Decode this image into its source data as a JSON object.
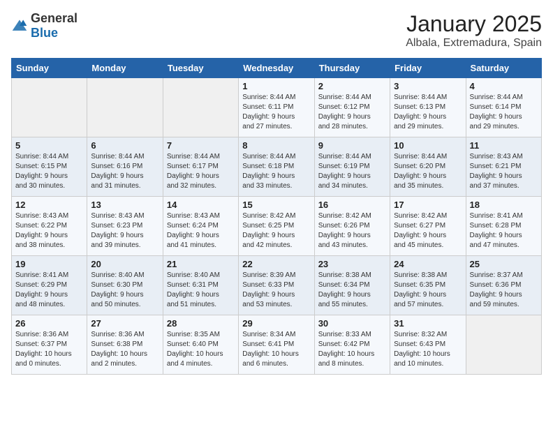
{
  "header": {
    "logo_general": "General",
    "logo_blue": "Blue",
    "month_year": "January 2025",
    "location": "Albala, Extremadura, Spain"
  },
  "weekdays": [
    "Sunday",
    "Monday",
    "Tuesday",
    "Wednesday",
    "Thursday",
    "Friday",
    "Saturday"
  ],
  "weeks": [
    [
      {
        "day": "",
        "detail": ""
      },
      {
        "day": "",
        "detail": ""
      },
      {
        "day": "",
        "detail": ""
      },
      {
        "day": "1",
        "detail": "Sunrise: 8:44 AM\nSunset: 6:11 PM\nDaylight: 9 hours\nand 27 minutes."
      },
      {
        "day": "2",
        "detail": "Sunrise: 8:44 AM\nSunset: 6:12 PM\nDaylight: 9 hours\nand 28 minutes."
      },
      {
        "day": "3",
        "detail": "Sunrise: 8:44 AM\nSunset: 6:13 PM\nDaylight: 9 hours\nand 29 minutes."
      },
      {
        "day": "4",
        "detail": "Sunrise: 8:44 AM\nSunset: 6:14 PM\nDaylight: 9 hours\nand 29 minutes."
      }
    ],
    [
      {
        "day": "5",
        "detail": "Sunrise: 8:44 AM\nSunset: 6:15 PM\nDaylight: 9 hours\nand 30 minutes."
      },
      {
        "day": "6",
        "detail": "Sunrise: 8:44 AM\nSunset: 6:16 PM\nDaylight: 9 hours\nand 31 minutes."
      },
      {
        "day": "7",
        "detail": "Sunrise: 8:44 AM\nSunset: 6:17 PM\nDaylight: 9 hours\nand 32 minutes."
      },
      {
        "day": "8",
        "detail": "Sunrise: 8:44 AM\nSunset: 6:18 PM\nDaylight: 9 hours\nand 33 minutes."
      },
      {
        "day": "9",
        "detail": "Sunrise: 8:44 AM\nSunset: 6:19 PM\nDaylight: 9 hours\nand 34 minutes."
      },
      {
        "day": "10",
        "detail": "Sunrise: 8:44 AM\nSunset: 6:20 PM\nDaylight: 9 hours\nand 35 minutes."
      },
      {
        "day": "11",
        "detail": "Sunrise: 8:43 AM\nSunset: 6:21 PM\nDaylight: 9 hours\nand 37 minutes."
      }
    ],
    [
      {
        "day": "12",
        "detail": "Sunrise: 8:43 AM\nSunset: 6:22 PM\nDaylight: 9 hours\nand 38 minutes."
      },
      {
        "day": "13",
        "detail": "Sunrise: 8:43 AM\nSunset: 6:23 PM\nDaylight: 9 hours\nand 39 minutes."
      },
      {
        "day": "14",
        "detail": "Sunrise: 8:43 AM\nSunset: 6:24 PM\nDaylight: 9 hours\nand 41 minutes."
      },
      {
        "day": "15",
        "detail": "Sunrise: 8:42 AM\nSunset: 6:25 PM\nDaylight: 9 hours\nand 42 minutes."
      },
      {
        "day": "16",
        "detail": "Sunrise: 8:42 AM\nSunset: 6:26 PM\nDaylight: 9 hours\nand 43 minutes."
      },
      {
        "day": "17",
        "detail": "Sunrise: 8:42 AM\nSunset: 6:27 PM\nDaylight: 9 hours\nand 45 minutes."
      },
      {
        "day": "18",
        "detail": "Sunrise: 8:41 AM\nSunset: 6:28 PM\nDaylight: 9 hours\nand 47 minutes."
      }
    ],
    [
      {
        "day": "19",
        "detail": "Sunrise: 8:41 AM\nSunset: 6:29 PM\nDaylight: 9 hours\nand 48 minutes."
      },
      {
        "day": "20",
        "detail": "Sunrise: 8:40 AM\nSunset: 6:30 PM\nDaylight: 9 hours\nand 50 minutes."
      },
      {
        "day": "21",
        "detail": "Sunrise: 8:40 AM\nSunset: 6:31 PM\nDaylight: 9 hours\nand 51 minutes."
      },
      {
        "day": "22",
        "detail": "Sunrise: 8:39 AM\nSunset: 6:33 PM\nDaylight: 9 hours\nand 53 minutes."
      },
      {
        "day": "23",
        "detail": "Sunrise: 8:38 AM\nSunset: 6:34 PM\nDaylight: 9 hours\nand 55 minutes."
      },
      {
        "day": "24",
        "detail": "Sunrise: 8:38 AM\nSunset: 6:35 PM\nDaylight: 9 hours\nand 57 minutes."
      },
      {
        "day": "25",
        "detail": "Sunrise: 8:37 AM\nSunset: 6:36 PM\nDaylight: 9 hours\nand 59 minutes."
      }
    ],
    [
      {
        "day": "26",
        "detail": "Sunrise: 8:36 AM\nSunset: 6:37 PM\nDaylight: 10 hours\nand 0 minutes."
      },
      {
        "day": "27",
        "detail": "Sunrise: 8:36 AM\nSunset: 6:38 PM\nDaylight: 10 hours\nand 2 minutes."
      },
      {
        "day": "28",
        "detail": "Sunrise: 8:35 AM\nSunset: 6:40 PM\nDaylight: 10 hours\nand 4 minutes."
      },
      {
        "day": "29",
        "detail": "Sunrise: 8:34 AM\nSunset: 6:41 PM\nDaylight: 10 hours\nand 6 minutes."
      },
      {
        "day": "30",
        "detail": "Sunrise: 8:33 AM\nSunset: 6:42 PM\nDaylight: 10 hours\nand 8 minutes."
      },
      {
        "day": "31",
        "detail": "Sunrise: 8:32 AM\nSunset: 6:43 PM\nDaylight: 10 hours\nand 10 minutes."
      },
      {
        "day": "",
        "detail": ""
      }
    ]
  ]
}
